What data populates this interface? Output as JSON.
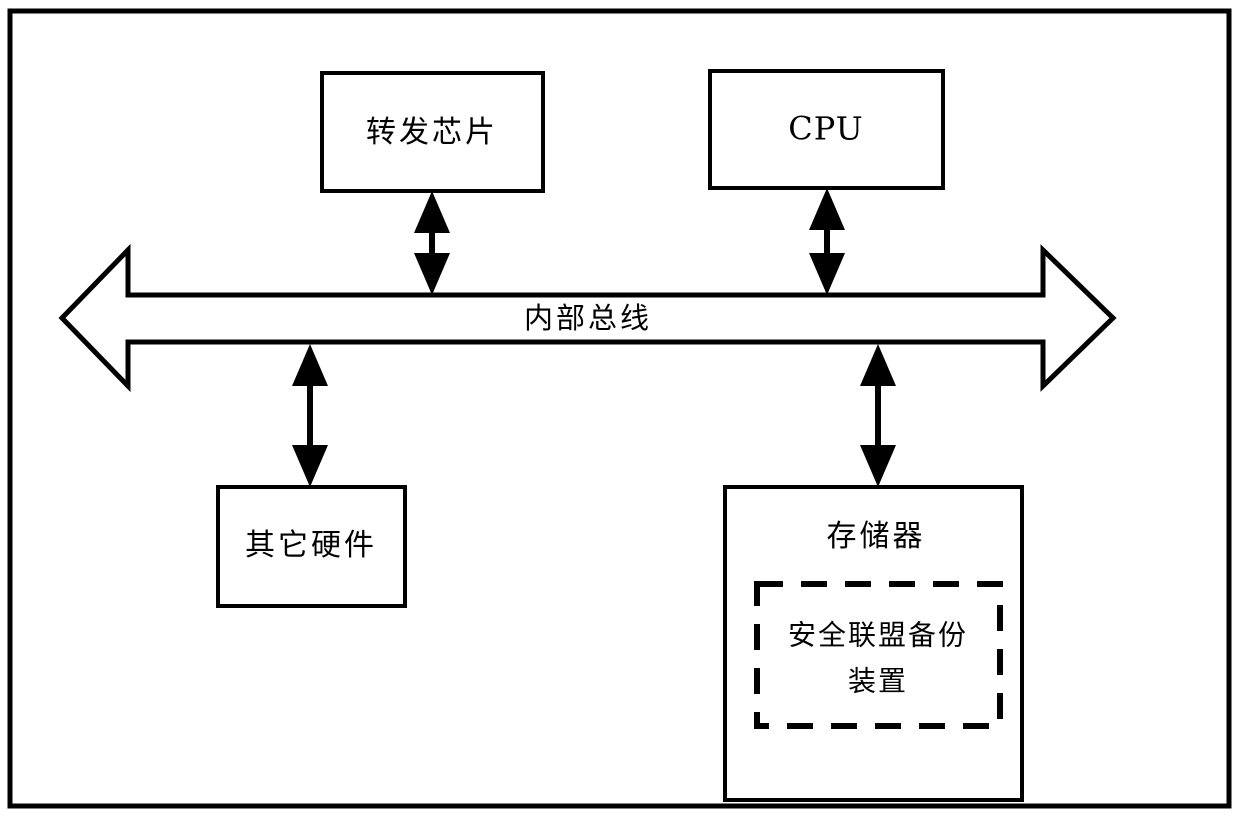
{
  "diagram": {
    "title_text": "",
    "frame": {
      "name": "outer-frame"
    },
    "nodes": {
      "forwarding_chip": {
        "label": "转发芯片"
      },
      "cpu": {
        "label": "CPU"
      },
      "bus": {
        "label": "内部总线"
      },
      "other_hardware": {
        "label": "其它硬件"
      },
      "memory": {
        "label": "存储器"
      },
      "sa_backup_device": {
        "label_line1": "安全联盟备份",
        "label_line2": "装置"
      }
    },
    "connectors": [
      {
        "name": "chip-to-bus",
        "type": "double-arrow"
      },
      {
        "name": "cpu-to-bus",
        "type": "double-arrow"
      },
      {
        "name": "bus-to-other-hardware",
        "type": "double-arrow"
      },
      {
        "name": "bus-to-memory",
        "type": "double-arrow"
      }
    ],
    "colors": {
      "stroke": "#000000",
      "background": "#ffffff"
    }
  }
}
